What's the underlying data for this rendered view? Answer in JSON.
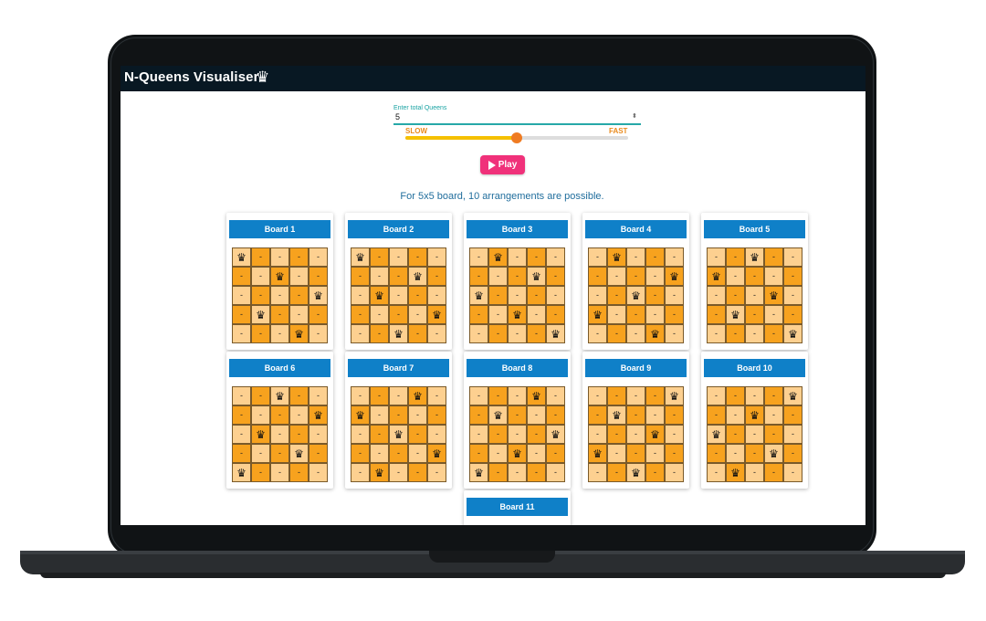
{
  "app": {
    "title": "N-Queens Visualiser",
    "title_icon": "crown-icon",
    "input": {
      "label": "Enter total Queens",
      "value": "5",
      "spinner_icon": "spinner-arrows-icon"
    },
    "speed": {
      "slow_label": "SLOW",
      "fast_label": "FAST",
      "value_percent": 50
    },
    "play_button": {
      "label": "Play",
      "icon": "play-icon"
    },
    "result_text": "For 5x5 board, 10 arrangements are possible.",
    "board_size": 5,
    "queen_glyph": "♛",
    "empty_glyph": "-",
    "colors": {
      "light": "#fdd090",
      "dark": "#f7a21e",
      "header": "#0f80c8",
      "accent": "#f0317a"
    },
    "boards": [
      {
        "label": "Board 1",
        "queens": [
          0,
          2,
          4,
          1,
          3
        ]
      },
      {
        "label": "Board 2",
        "queens": [
          0,
          3,
          1,
          4,
          2
        ]
      },
      {
        "label": "Board 3",
        "queens": [
          1,
          3,
          0,
          2,
          4
        ]
      },
      {
        "label": "Board 4",
        "queens": [
          1,
          4,
          2,
          0,
          3
        ]
      },
      {
        "label": "Board 5",
        "queens": [
          2,
          0,
          3,
          1,
          4
        ]
      },
      {
        "label": "Board 6",
        "queens": [
          2,
          4,
          1,
          3,
          0
        ]
      },
      {
        "label": "Board 7",
        "queens": [
          3,
          0,
          2,
          4,
          1
        ]
      },
      {
        "label": "Board 8",
        "queens": [
          3,
          1,
          4,
          2,
          0
        ]
      },
      {
        "label": "Board 9",
        "queens": [
          4,
          1,
          3,
          0,
          2
        ]
      },
      {
        "label": "Board 10",
        "queens": [
          4,
          2,
          0,
          3,
          1
        ]
      },
      {
        "label": "Board 11",
        "queens": []
      }
    ]
  }
}
